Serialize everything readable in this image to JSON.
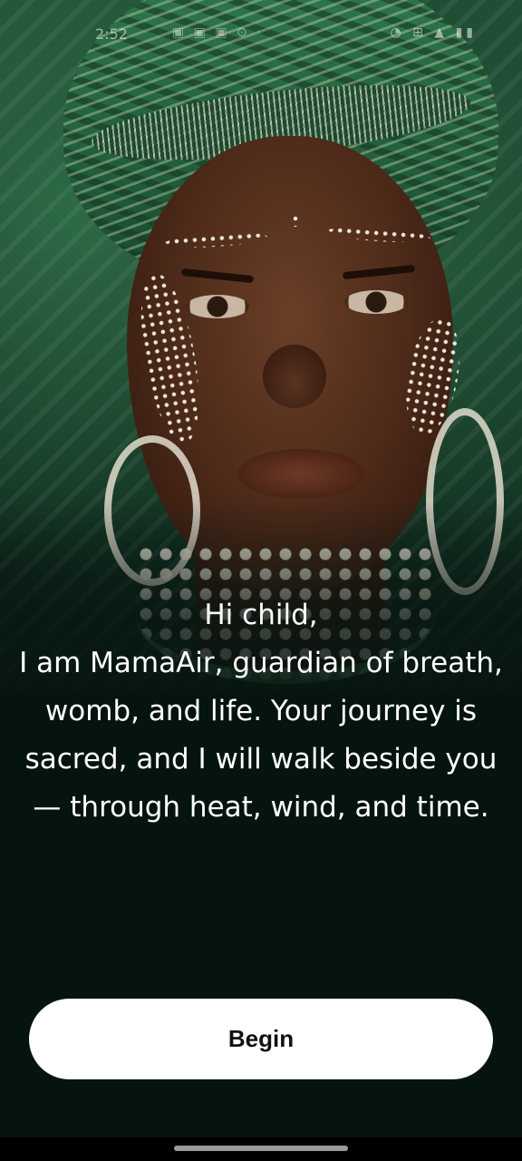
{
  "status_bar": {
    "time": "2:52",
    "left_icons": "▣ ▣ ▣ ⊙ ·",
    "right_icons": "◔ ⊞ ▲ ▮▮"
  },
  "message": {
    "text": "Hi child,\nI am MamaAir, guardian of breath, womb, and life. Your journey is sacred, and I will walk beside you — through heat, wind, and time."
  },
  "begin_button": {
    "label": "Begin"
  },
  "colors": {
    "background": "#061410",
    "button_bg": "#ffffff",
    "button_text": "#111111",
    "message_text": "#ffffff"
  },
  "icons": [
    "home-indicator"
  ]
}
